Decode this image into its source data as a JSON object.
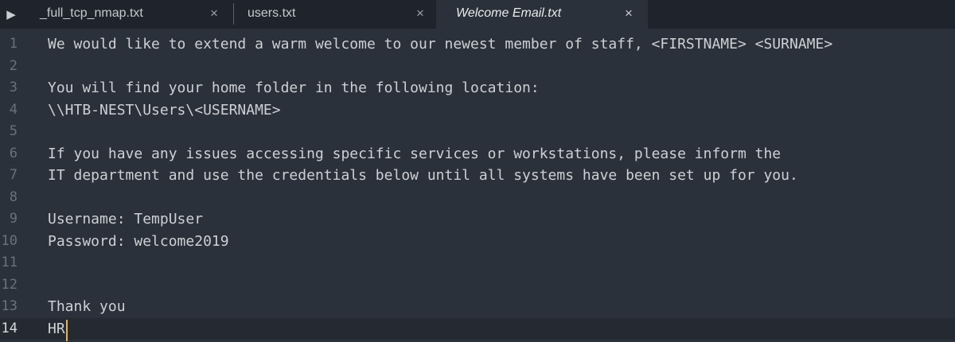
{
  "tabs": [
    {
      "label": "_full_tcp_nmap.txt",
      "close": "×",
      "active": false
    },
    {
      "label": "users.txt",
      "close": "×",
      "active": false
    },
    {
      "label": "Welcome Email.txt",
      "close": "×",
      "active": true
    }
  ],
  "sidebar_toggle": "▶",
  "editor": {
    "current_line": 14,
    "lines": [
      {
        "number": "1",
        "text": "We would like to extend a warm welcome to our newest member of staff, <FIRSTNAME> <SURNAME>"
      },
      {
        "number": "2",
        "text": ""
      },
      {
        "number": "3",
        "text": "You will find your home folder in the following location:"
      },
      {
        "number": "4",
        "text": "\\\\HTB-NEST\\Users\\<USERNAME>"
      },
      {
        "number": "5",
        "text": ""
      },
      {
        "number": "6",
        "text": "If you have any issues accessing specific services or workstations, please inform the"
      },
      {
        "number": "7",
        "text": "IT department and use the credentials below until all systems have been set up for you."
      },
      {
        "number": "8",
        "text": ""
      },
      {
        "number": "9",
        "text": "Username: TempUser"
      },
      {
        "number": "10",
        "text": "Password: welcome2019"
      },
      {
        "number": "11",
        "text": ""
      },
      {
        "number": "12",
        "text": ""
      },
      {
        "number": "13",
        "text": "Thank you"
      },
      {
        "number": "14",
        "text": "HR"
      }
    ]
  },
  "colors": {
    "background": "#2b313b",
    "tabbar": "#1f242c",
    "text": "#cdd0d4",
    "line_number": "#6b717a",
    "caret": "#f0b429"
  }
}
